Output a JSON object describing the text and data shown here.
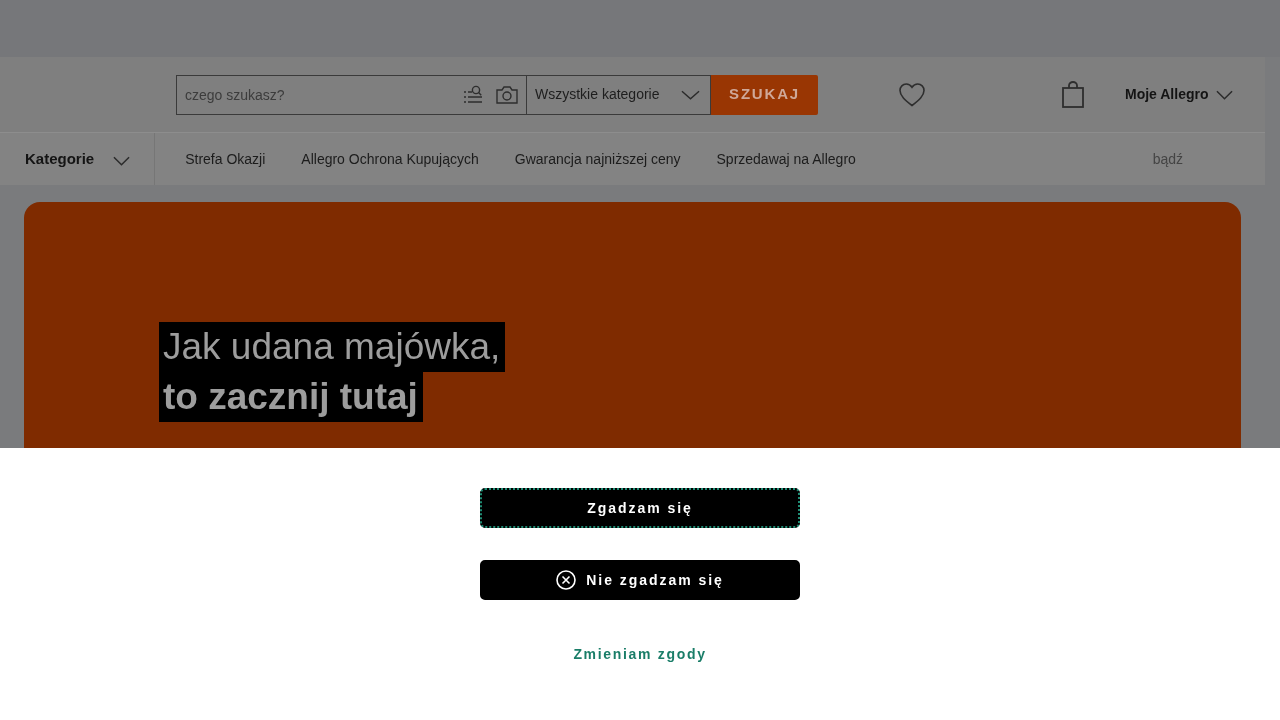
{
  "header": {
    "search": {
      "placeholder": "czego szukasz?"
    },
    "category_select": {
      "value": "Wszystkie kategorie"
    },
    "search_button": "SZUKAJ",
    "account": "Moje Allegro"
  },
  "nav": {
    "categories": "Kategorie",
    "links": [
      "Strefa Okazji",
      "Allegro Ochrona Kupujących",
      "Gwarancja najniższej ceny",
      "Sprzedawaj na Allegro"
    ],
    "trailing": "bądź"
  },
  "banner": {
    "lines": [
      {
        "text": "Jak udana majówka,",
        "bold": false
      },
      {
        "text": "to zacznij tutaj",
        "bold": true
      }
    ]
  },
  "consent": {
    "buttons": [
      {
        "label": "Zgadzam się",
        "kind": "accept",
        "focused": true
      },
      {
        "label": "Nie zgadzam się",
        "kind": "reject",
        "focused": false
      }
    ],
    "link": "Zmieniam zgody"
  }
}
